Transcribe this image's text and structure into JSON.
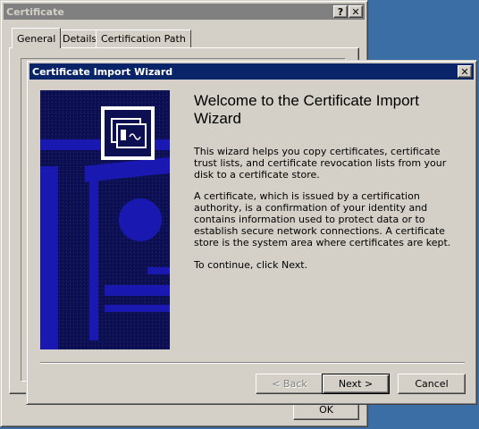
{
  "certificate_window": {
    "title": "Certificate",
    "help_glyph": "?",
    "close_glyph": "✕",
    "tabs": [
      {
        "label": "General"
      },
      {
        "label": "Details"
      },
      {
        "label": "Certification Path"
      }
    ],
    "ok_label": "OK"
  },
  "wizard": {
    "title": "Certificate Import Wizard",
    "close_glyph": "✕",
    "heading": "Welcome to the Certificate Import Wizard",
    "paragraphs": [
      "This wizard helps you copy certificates, certificate trust lists, and certificate revocation lists from your disk to a certificate store.",
      "A certificate, which is issued by a certification authority, is a confirmation of your identity and contains information used to protect data or to establish secure network connections. A certificate store is the system area where certificates are kept.",
      "To continue, click Next."
    ],
    "buttons": {
      "back": "< Back",
      "next": "Next >",
      "cancel": "Cancel"
    },
    "banner_icon": "certificate-icon"
  },
  "colors": {
    "desktop": "#3a6ea5",
    "active_title": "#0a246a",
    "inactive_title": "#808080",
    "banner_dark": "#0c1052",
    "banner_pattern": "#1a1ab8"
  }
}
